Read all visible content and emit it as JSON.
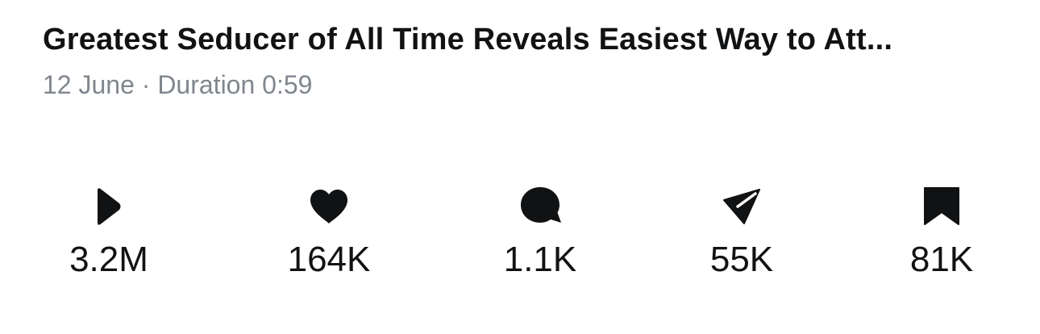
{
  "video": {
    "title": "Greatest Seducer of All Time Reveals Easiest Way to Att...",
    "date": "12 June",
    "separator": " · ",
    "duration": "Duration 0:59"
  },
  "stats": {
    "plays": {
      "icon": "play-icon",
      "count": "3.2M"
    },
    "likes": {
      "icon": "heart-icon",
      "count": "164K"
    },
    "comments": {
      "icon": "comment-icon",
      "count": "1.1K"
    },
    "shares": {
      "icon": "share-icon",
      "count": "55K"
    },
    "saves": {
      "icon": "bookmark-icon",
      "count": "81K"
    }
  }
}
